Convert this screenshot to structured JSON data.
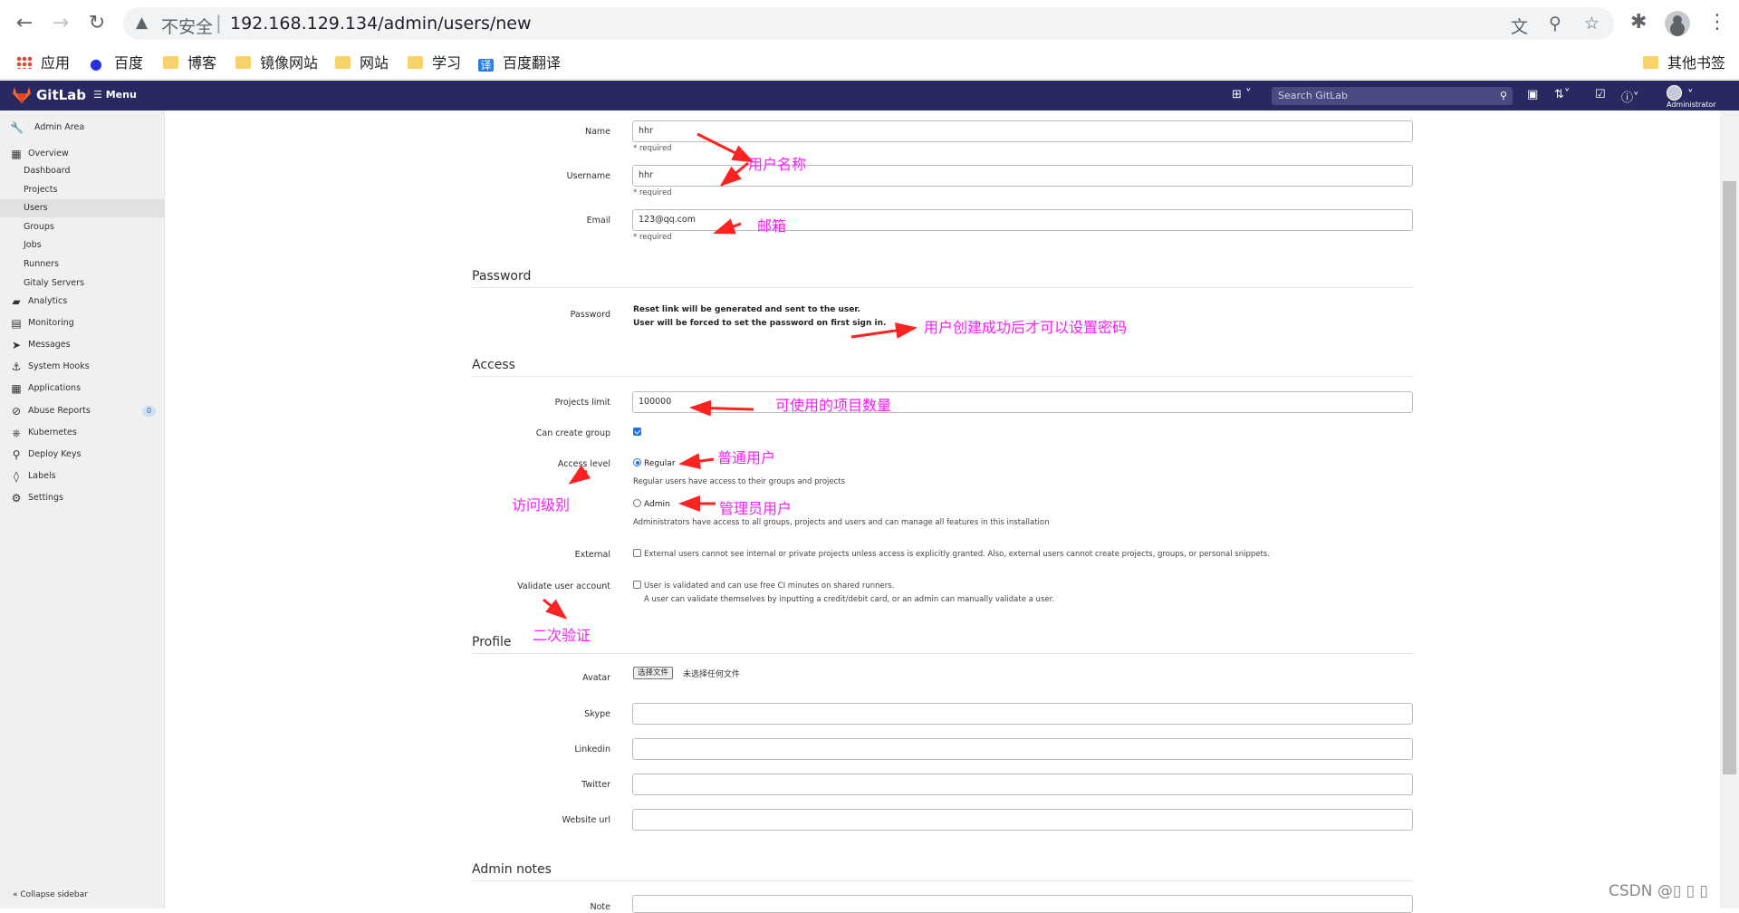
{
  "browser": {
    "insecure_label": "不安全",
    "url": "192.168.129.134/admin/users/new",
    "bookmarks": [
      "应用",
      "百度",
      "博客",
      "镜像网站",
      "网站",
      "学习",
      "百度翻译"
    ],
    "other_bookmarks": "其他书签"
  },
  "header": {
    "brand": "GitLab",
    "menu_label": "Menu",
    "search_placeholder": "Search GitLab",
    "user_label": "Administrator"
  },
  "sidebar": {
    "title": "Admin Area",
    "items": [
      {
        "label": "Overview",
        "icon": "overview-icon"
      },
      {
        "label": "Dashboard"
      },
      {
        "label": "Projects"
      },
      {
        "label": "Users"
      },
      {
        "label": "Groups"
      },
      {
        "label": "Jobs"
      },
      {
        "label": "Runners"
      },
      {
        "label": "Gitaly Servers"
      },
      {
        "label": "Analytics",
        "icon": "analytics-icon"
      },
      {
        "label": "Monitoring",
        "icon": "monitoring-icon"
      },
      {
        "label": "Messages",
        "icon": "messages-icon"
      },
      {
        "label": "System Hooks",
        "icon": "hook-icon"
      },
      {
        "label": "Applications",
        "icon": "applications-icon"
      },
      {
        "label": "Abuse Reports",
        "icon": "abuse-icon",
        "badge": "0"
      },
      {
        "label": "Kubernetes",
        "icon": "kubernetes-icon"
      },
      {
        "label": "Deploy Keys",
        "icon": "key-icon"
      },
      {
        "label": "Labels",
        "icon": "label-icon"
      },
      {
        "label": "Settings",
        "icon": "gear-icon"
      }
    ],
    "collapse_label": "Collapse sidebar"
  },
  "form": {
    "account": {
      "name_label": "Name",
      "name_value": "hhr",
      "username_label": "Username",
      "username_value": "hhr",
      "email_label": "Email",
      "email_value": "123@qq.com",
      "required": "* required"
    },
    "password": {
      "section_title": "Password",
      "label": "Password",
      "line1": "Reset link will be generated and sent to the user.",
      "line2": "User will be forced to set the password on first sign in."
    },
    "access": {
      "section_title": "Access",
      "projects_limit_label": "Projects limit",
      "projects_limit_value": "100000",
      "can_create_group_label": "Can create group",
      "can_create_group_checked": true,
      "access_level_label": "Access level",
      "regular_label": "Regular",
      "regular_help": "Regular users have access to their groups and projects",
      "admin_label": "Admin",
      "admin_help": "Administrators have access to all groups, projects and users and can manage all features in this installation",
      "selected_level": "Regular",
      "external_label": "External",
      "external_help": "External users cannot see internal or private projects unless access is explicitly granted. Also, external users cannot create projects, groups, or personal snippets.",
      "validate_label": "Validate user account",
      "validate_help1": "User is validated and can use free CI minutes on shared runners.",
      "validate_help2": "A user can validate themselves by inputting a credit/debit card, or an admin can manually validate a user."
    },
    "profile": {
      "section_title": "Profile",
      "avatar_label": "Avatar",
      "choose_file": "选择文件",
      "no_file": "未选择任何文件",
      "skype_label": "Skype",
      "linkedin_label": "Linkedin",
      "twitter_label": "Twitter",
      "website_label": "Website url"
    },
    "admin_notes": {
      "section_title": "Admin notes",
      "note_label": "Note"
    }
  },
  "annotations": {
    "username": "用户名称",
    "email": "邮箱",
    "password": "用户创建成功后才可以设置密码",
    "projects_limit": "可使用的项目数量",
    "regular": "普通用户",
    "admin": "管理员用户",
    "access_level": "访问级别",
    "validate": "二次验证",
    "color": "#ff1aff"
  },
  "watermark": "CSDN @▯ ▯ ▯"
}
